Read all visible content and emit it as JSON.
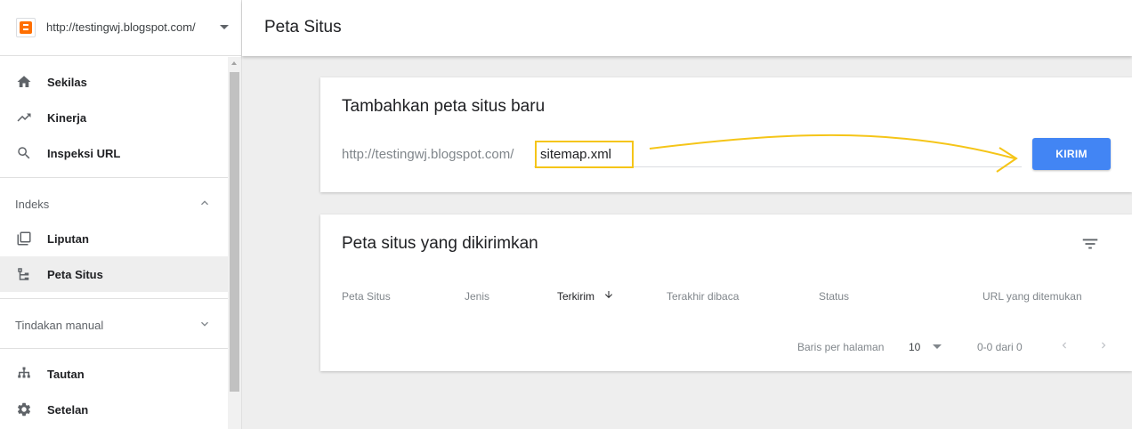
{
  "property": {
    "url": "http://testingwj.blogspot.com/"
  },
  "nav": {
    "items_top": [
      {
        "label": "Sekilas",
        "icon": "home-icon"
      },
      {
        "label": "Kinerja",
        "icon": "trending-up-icon"
      },
      {
        "label": "Inspeksi URL",
        "icon": "search-icon"
      }
    ],
    "section_index": {
      "label": "Indeks"
    },
    "items_index": [
      {
        "label": "Liputan",
        "icon": "copy-icon"
      },
      {
        "label": "Peta Situs",
        "icon": "sitemap-icon"
      }
    ],
    "section_manual": {
      "label": "Tindakan manual"
    },
    "items_bottom": [
      {
        "label": "Tautan",
        "icon": "links-icon"
      },
      {
        "label": "Setelan",
        "icon": "settings-icon"
      }
    ]
  },
  "header": {
    "title": "Peta Situs"
  },
  "add_card": {
    "title": "Tambahkan peta situs baru",
    "prefix": "http://testingwj.blogspot.com/",
    "input_value": "sitemap.xml",
    "submit_label": "KIRIM"
  },
  "submitted_card": {
    "title": "Peta situs yang dikirimkan",
    "columns": [
      "Peta Situs",
      "Jenis",
      "Terkirim",
      "Terakhir dibaca",
      "Status",
      "URL yang ditemukan"
    ],
    "rows_per_page_label": "Baris per halaman",
    "rows_per_page_value": "10",
    "range": "0-0 dari 0"
  },
  "colors": {
    "accent": "#4285f4",
    "highlight": "#f5c518",
    "blogger": "#ff6f00"
  }
}
